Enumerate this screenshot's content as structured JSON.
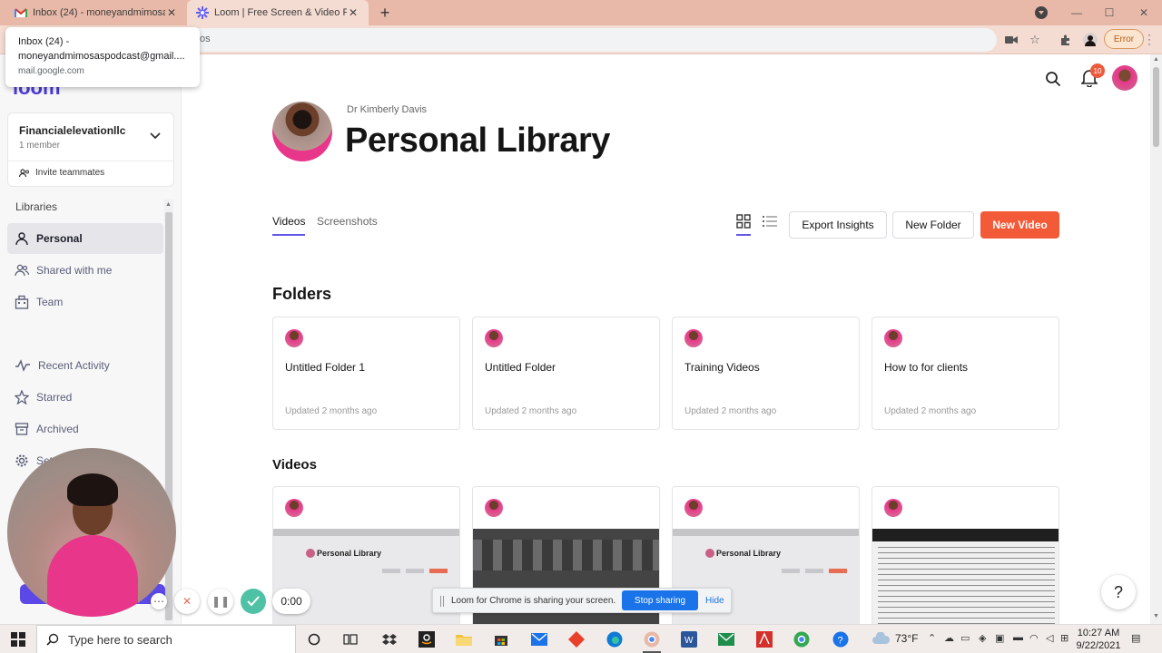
{
  "browser": {
    "tabs": [
      {
        "title": "Inbox (24) - moneyandmimosaspodcast@gmail.com",
        "icon": "gmail-icon",
        "active": false
      },
      {
        "title": "Loom | Free Screen & Video Recording Software",
        "icon": "loom-icon",
        "active": true
      }
    ],
    "tooltip": {
      "line1": "Inbox (24) -",
      "line2": "moneyandmimosaspodcast@gmail....",
      "domain": "mail.google.com"
    },
    "omnibox_text": "os",
    "error_label": "Error"
  },
  "sidebar": {
    "logo": "loom",
    "workspace": {
      "name": "Financialelevationllc",
      "members": "1 member"
    },
    "invite_label": "Invite teammates",
    "section_label": "Libraries",
    "library_items": [
      {
        "label": "Personal",
        "icon": "person-icon"
      },
      {
        "label": "Shared with me",
        "icon": "people-icon"
      },
      {
        "label": "Team",
        "icon": "building-icon"
      }
    ],
    "other_items": [
      {
        "label": "Recent Activity",
        "icon": "activity-icon"
      },
      {
        "label": "Starred",
        "icon": "star-icon"
      },
      {
        "label": "Archived",
        "icon": "archive-icon"
      },
      {
        "label": "Settings",
        "icon": "gear-icon"
      }
    ]
  },
  "header": {
    "notification_count": "10"
  },
  "library": {
    "owner": "Dr Kimberly Davis",
    "title": "Personal Library",
    "tabs": [
      "Videos",
      "Screenshots"
    ],
    "buttons": {
      "export": "Export Insights",
      "new_folder": "New Folder",
      "new_video": "New Video"
    },
    "folders_title": "Folders",
    "folders": [
      {
        "name": "Untitled Folder 1",
        "updated": "Updated 2 months ago"
      },
      {
        "name": "Untitled Folder",
        "updated": "Updated 2 months ago"
      },
      {
        "name": "Training Videos",
        "updated": "Updated 2 months ago"
      },
      {
        "name": "How to for clients",
        "updated": "Updated 2 months ago"
      }
    ],
    "videos_title": "Videos",
    "video_thumb_title": "Personal Library"
  },
  "recording": {
    "timer": "0:00"
  },
  "sharing_bar": {
    "message": "Loom for Chrome is sharing your screen.",
    "stop_label": "Stop sharing",
    "hide_label": "Hide"
  },
  "help_label": "?",
  "taskbar": {
    "search_placeholder": "Type here to search",
    "weather": "73°F",
    "time": "10:27 AM",
    "date": "9/22/2021"
  },
  "colors": {
    "accent": "#6456e9",
    "primary_button": "#f25a38",
    "loom_brand": "#4a3ad9",
    "tabstrip": "#e8b9a8"
  }
}
